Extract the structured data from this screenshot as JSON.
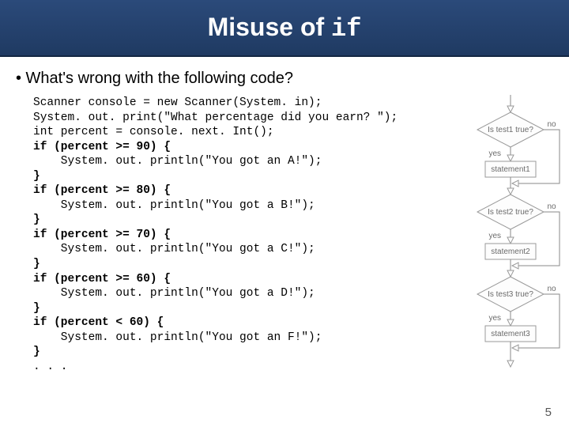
{
  "title": {
    "prefix": "Misuse of ",
    "keyword": "if"
  },
  "bullet": "• What's wrong with the following code?",
  "code": {
    "l01": "Scanner console = new Scanner(System. in);",
    "l02": "System. out. print(\"What percentage did you earn? \");",
    "l03": "int percent = console. next. Int();",
    "l04": "if (percent >= 90) {",
    "l05": "    System. out. println(\"You got an A!\");",
    "l06": "}",
    "l07": "if (percent >= 80) {",
    "l08": "    System. out. println(\"You got a B!\");",
    "l09": "}",
    "l10": "if (percent >= 70) {",
    "l11": "    System. out. println(\"You got a C!\");",
    "l12": "}",
    "l13": "if (percent >= 60) {",
    "l14": "    System. out. println(\"You got a D!\");",
    "l15": "}",
    "l16": "if (percent < 60) {",
    "l17": "    System. out. println(\"You got an F!\");",
    "l18": "}",
    "l19": ". . ."
  },
  "flowchart": {
    "d1": "Is test1 true?",
    "s1": "statement1",
    "d2": "Is test2 true?",
    "s2": "statement2",
    "d3": "Is test3 true?",
    "s3": "statement3",
    "yes": "yes",
    "no": "no"
  },
  "page_number": "5"
}
